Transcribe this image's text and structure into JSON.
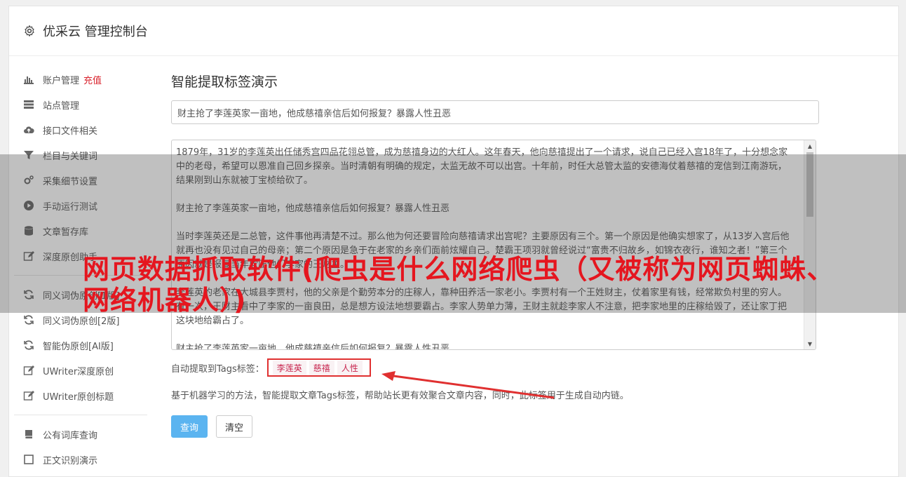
{
  "header": {
    "title": "优采云 管理控制台",
    "icon": "gear-icon"
  },
  "sidebar": {
    "items": [
      {
        "label": "账户管理",
        "badge": "充值",
        "icon": "bar-chart-icon"
      },
      {
        "label": "站点管理",
        "icon": "server-icon"
      },
      {
        "label": "接口文件相关",
        "icon": "cloud-upload-icon"
      },
      {
        "label": "栏目与关键词",
        "icon": "filter-icon"
      },
      {
        "label": "采集细节设置",
        "icon": "cogs-icon"
      },
      {
        "label": "手动运行测试",
        "icon": "play-circle-icon"
      },
      {
        "label": "文章暂存库",
        "icon": "database-icon"
      },
      {
        "label": "深度原创助手",
        "icon": "edit-icon"
      },
      {
        "label": "同义词伪原创[1版]",
        "icon": "refresh-icon"
      },
      {
        "label": "同义词伪原创[2版]",
        "icon": "refresh-icon"
      },
      {
        "label": "智能伪原创[AI版]",
        "icon": "refresh-icon"
      },
      {
        "label": "UWriter深度原创",
        "icon": "edit-icon"
      },
      {
        "label": "UWriter原创标题",
        "icon": "edit-icon"
      },
      {
        "label": "公有词库查询",
        "icon": "book-icon"
      },
      {
        "label": "正文识别演示",
        "icon": "square-icon"
      }
    ]
  },
  "main": {
    "section_title": "智能提取标签演示",
    "title_value": "财主抢了李莲英家一亩地，他成慈禧亲信后如何报复？暴露人性丑恶",
    "paragraphs": [
      "1879年，31岁的李莲英出任储秀宫四品花翎总管，成为慈禧身边的大红人。这年春天，他向慈禧提出了一个请求，说自己已经入宫18年了，十分想念家中的老母，希望可以恩准自己回乡探亲。当时清朝有明确的规定，太监无故不可以出宫。十年前，时任大总管太监的安德海仗着慈禧的宠信到江南游玩，结果刚到山东就被丁宝桢给砍了。",
      "财主抢了李莲英家一亩地，他成慈禧亲信后如何报复？暴露人性丑恶",
      "当时李莲英还是二总管，这件事他再清楚不过。那么他为何还要冒险向慈禧请求出宫呢？主要原因有三个。第一个原因是他确实想家了，从13岁入宫后他就再也没有见过自己的母亲；第二个原因是急于在老家的乡亲们面前炫耀自己。楚霸王项羽就曾经说过“富贵不归故乡，如锦衣夜行，谁知之者！”第三个原因就是报复当年欺压他们李家的王财主。",
      "李莲英的老家在大城县李贾村，他的父亲是个勤劳本分的庄稼人，靠种田养活一家老小。李贾村有一个王姓财主，仗着家里有钱，经常欺负村里的穷人。有一次，王财主看中了李家的一亩良田，总是想方设法地想要霸占。李家人势单力薄，王财主就趁李家人不注意，把李家地里的庄稼给毁了，还让家丁把这块地给霸占了。",
      "财主抢了李莲英家一亩地，他成慈禧亲信后如何报复？暴露人性丑恶"
    ],
    "tags_label": "自动提取到Tags标签：",
    "tags": [
      "李莲英",
      "慈禧",
      "人性"
    ],
    "help_text": "基于机器学习的方法，智能提取文章Tags标签，帮助站长更有效聚合文章内容，同时，此标签用于生成自动内链。",
    "query_button": "查询",
    "clear_button": "清空"
  },
  "overlay": {
    "headline": "网页数据抓取软件(爬虫是什么网络爬虫（又被称为网页蜘蛛、网络机器人）)",
    "headline_color": "#e5161f"
  }
}
